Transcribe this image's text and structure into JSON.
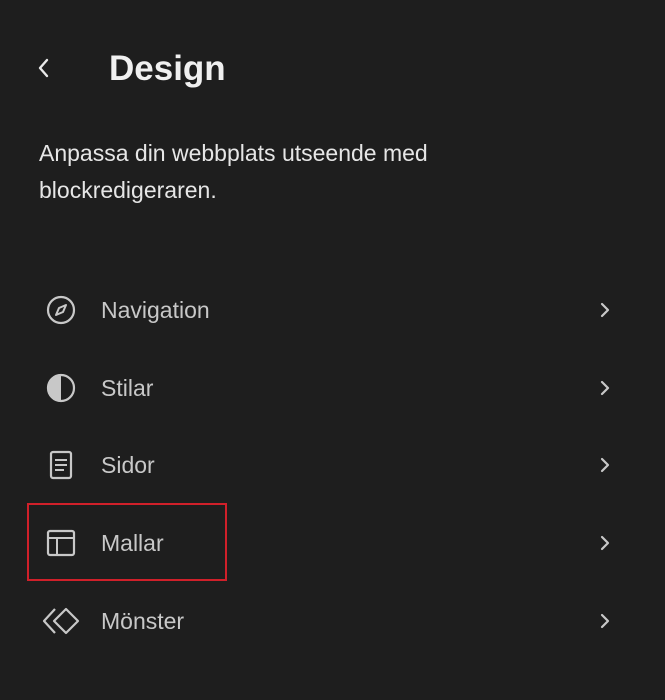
{
  "header": {
    "title": "Design",
    "back_icon": "chevron-left-icon"
  },
  "description": "Anpassa din webbplats utseende med blockredigeraren.",
  "menu": {
    "items": [
      {
        "label": "Navigation",
        "icon": "compass-icon"
      },
      {
        "label": "Stilar",
        "icon": "half-circle-icon"
      },
      {
        "label": "Sidor",
        "icon": "page-icon"
      },
      {
        "label": "Mallar",
        "icon": "layout-icon",
        "highlighted": true
      },
      {
        "label": "Mönster",
        "icon": "diamond-pattern-icon"
      }
    ],
    "chevron_icon": "chevron-right-icon"
  },
  "colors": {
    "background": "#1e1e1e",
    "text": "#e0e0e0",
    "icon": "#c8c8c8",
    "highlight": "#d0202a"
  }
}
